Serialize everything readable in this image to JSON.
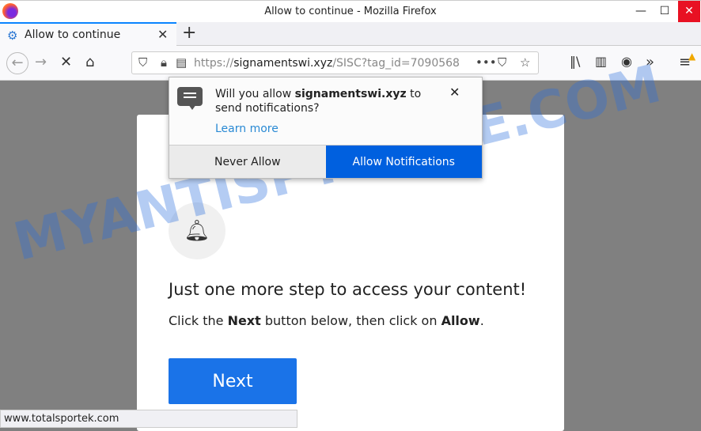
{
  "window": {
    "title": "Allow to continue - Mozilla Firefox",
    "minimize": "—",
    "maximize": "☐",
    "close": "✕"
  },
  "tab": {
    "label": "Allow to continue",
    "close": "✕",
    "new_tab": "+"
  },
  "urlbar": {
    "scheme": "https://",
    "domain": "signamentswi.xyz",
    "path": "/SISC?tag_id=7090568"
  },
  "popup": {
    "message_prefix": "Will you allow ",
    "domain": "signamentswi.xyz",
    "message_suffix": " to send notifications?",
    "learn_more": "Learn more",
    "never_allow": "Never Allow",
    "allow": "Allow Notifications"
  },
  "page": {
    "heading": "Just one more step to access your content!",
    "sub_prefix": "Click the ",
    "sub_next": "Next",
    "sub_mid": " button below, then click on ",
    "sub_allow": "Allow",
    "sub_end": ".",
    "next_button": "Next"
  },
  "status_url": "www.totalsportek.com",
  "watermark": "MYANTISPYWARE.COM"
}
